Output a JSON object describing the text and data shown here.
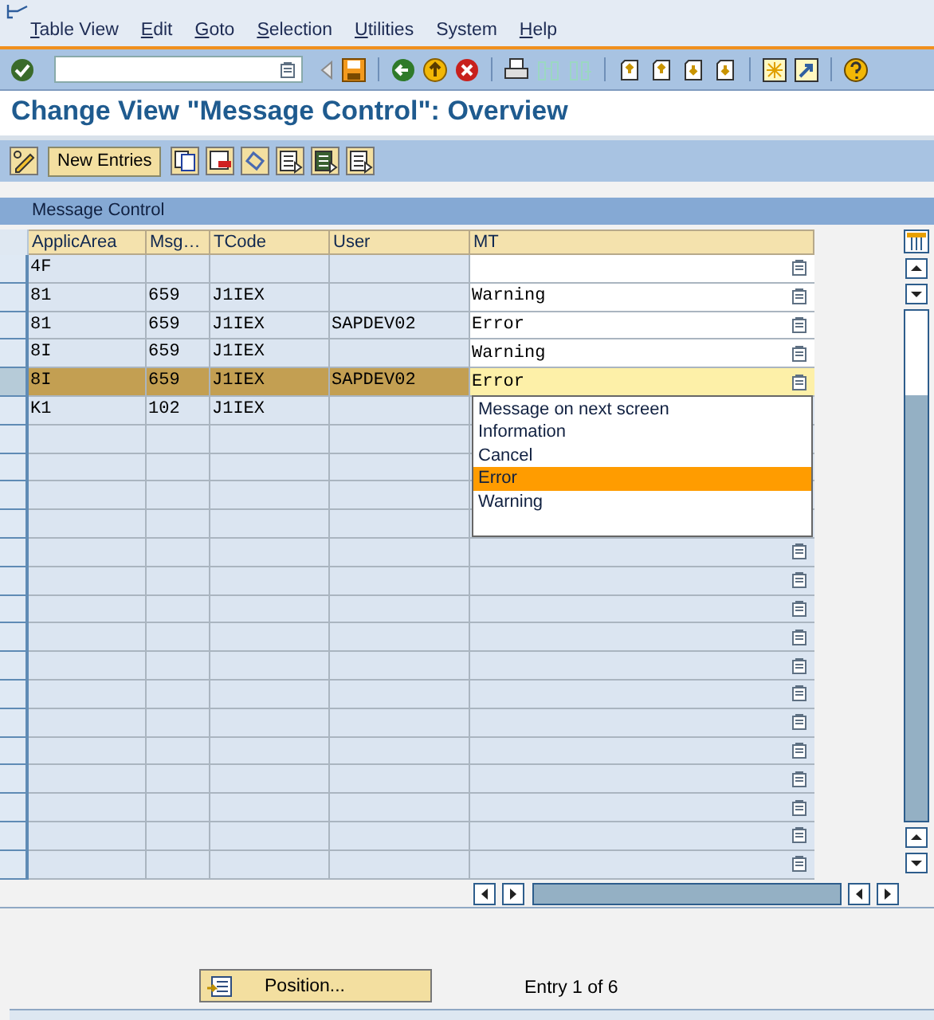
{
  "menu_bar": [
    {
      "label": "Table View",
      "mnemonic": true
    },
    {
      "label": "Edit",
      "mnemonic": true
    },
    {
      "label": "Goto",
      "mnemonic": true
    },
    {
      "label": "Selection",
      "mnemonic": true
    },
    {
      "label": "Utilities",
      "mnemonic": true
    },
    {
      "label": "System",
      "mnemonic": false
    },
    {
      "label": "Help",
      "mnemonic": true
    }
  ],
  "title": "Change View \"Message Control\": Overview",
  "app_toolbar": {
    "new_entries": "New Entries"
  },
  "table": {
    "title": "Message Control",
    "columns": [
      "ApplicArea",
      "Msg…",
      "TCode",
      "User",
      "MT"
    ],
    "rows": [
      {
        "kind": "entry",
        "selected": false,
        "cells": [
          "4F",
          "",
          "",
          "",
          ""
        ]
      },
      {
        "kind": "entry",
        "selected": false,
        "cells": [
          "81",
          "659",
          "J1IEX",
          "",
          "Warning"
        ]
      },
      {
        "kind": "entry",
        "selected": false,
        "cells": [
          "81",
          "659",
          "J1IEX",
          "SAPDEV02",
          "Error"
        ]
      },
      {
        "kind": "entry",
        "selected": false,
        "cells": [
          "8I",
          "659",
          "J1IEX",
          "",
          "Warning"
        ]
      },
      {
        "kind": "entry",
        "selected": true,
        "cells": [
          "8I",
          "659",
          "J1IEX",
          "SAPDEV02",
          "Error"
        ],
        "dropdown": {
          "options": [
            {
              "label": "Message on next screen",
              "selected": false
            },
            {
              "label": "Information",
              "selected": false
            },
            {
              "label": "Cancel",
              "selected": false
            },
            {
              "label": "Error",
              "selected": true
            },
            {
              "label": "Warning",
              "selected": false
            }
          ]
        }
      },
      {
        "kind": "key_only",
        "selected": false,
        "cells": [
          "K1",
          "102",
          "J1IEX",
          "",
          ""
        ]
      },
      {
        "kind": "covered",
        "selected": false
      },
      {
        "kind": "covered",
        "selected": false
      },
      {
        "kind": "covered",
        "selected": false
      },
      {
        "kind": "covered",
        "selected": false
      },
      {
        "kind": "blank",
        "selected": false
      },
      {
        "kind": "blank",
        "selected": false
      },
      {
        "kind": "blank",
        "selected": false
      },
      {
        "kind": "blank",
        "selected": false
      },
      {
        "kind": "blank",
        "selected": false
      },
      {
        "kind": "blank",
        "selected": false
      },
      {
        "kind": "blank",
        "selected": false
      },
      {
        "kind": "blank",
        "selected": false
      },
      {
        "kind": "blank",
        "selected": false
      },
      {
        "kind": "blank",
        "selected": false
      },
      {
        "kind": "blank",
        "selected": false
      },
      {
        "kind": "blank",
        "selected": false
      }
    ]
  },
  "footer": {
    "position_button": "Position...",
    "entry_count": "Entry 1 of 6"
  }
}
